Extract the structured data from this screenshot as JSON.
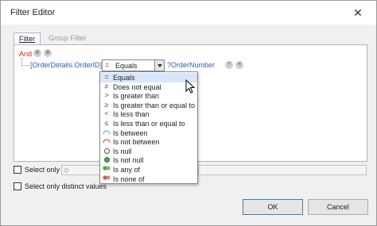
{
  "window": {
    "title": "Filter Editor",
    "close_glyph": "✕"
  },
  "tabs": [
    {
      "label": "Filter",
      "active": true
    },
    {
      "label": "Group Filter",
      "active": false
    }
  ],
  "filter": {
    "group_operator": "And",
    "field": "[OrderDetails.OrderID]",
    "operator_selected": "Equals",
    "value": "?OrderNumber"
  },
  "operator_list": [
    {
      "label": "Equals",
      "icon": "=",
      "selected": true
    },
    {
      "label": "Does not equal",
      "icon": "≠"
    },
    {
      "label": "Is greater than",
      "icon": ">"
    },
    {
      "label": "Is greater than or equal to",
      "icon": "≥"
    },
    {
      "label": "Is less than",
      "icon": "<"
    },
    {
      "label": "Is less than or equal to",
      "icon": "≤"
    },
    {
      "label": "Is between",
      "icon": "between-icon"
    },
    {
      "label": "Is not between",
      "icon": "not-between-icon"
    },
    {
      "label": "Is null",
      "icon": "null-icon"
    },
    {
      "label": "Is not null",
      "icon": "not-null-icon"
    },
    {
      "label": "Is any of",
      "icon": "any-of-icon"
    },
    {
      "label": "Is none of",
      "icon": "none-of-icon"
    }
  ],
  "options": {
    "select_only_label": "Select only",
    "select_only_from": "0",
    "select_distinct_label": "Select only distinct values"
  },
  "buttons": {
    "ok": "OK",
    "cancel": "Cancel"
  },
  "colors": {
    "group_operator": "#cc2222",
    "field": "#2f5fae",
    "selected_item": "#d7e6fa"
  }
}
